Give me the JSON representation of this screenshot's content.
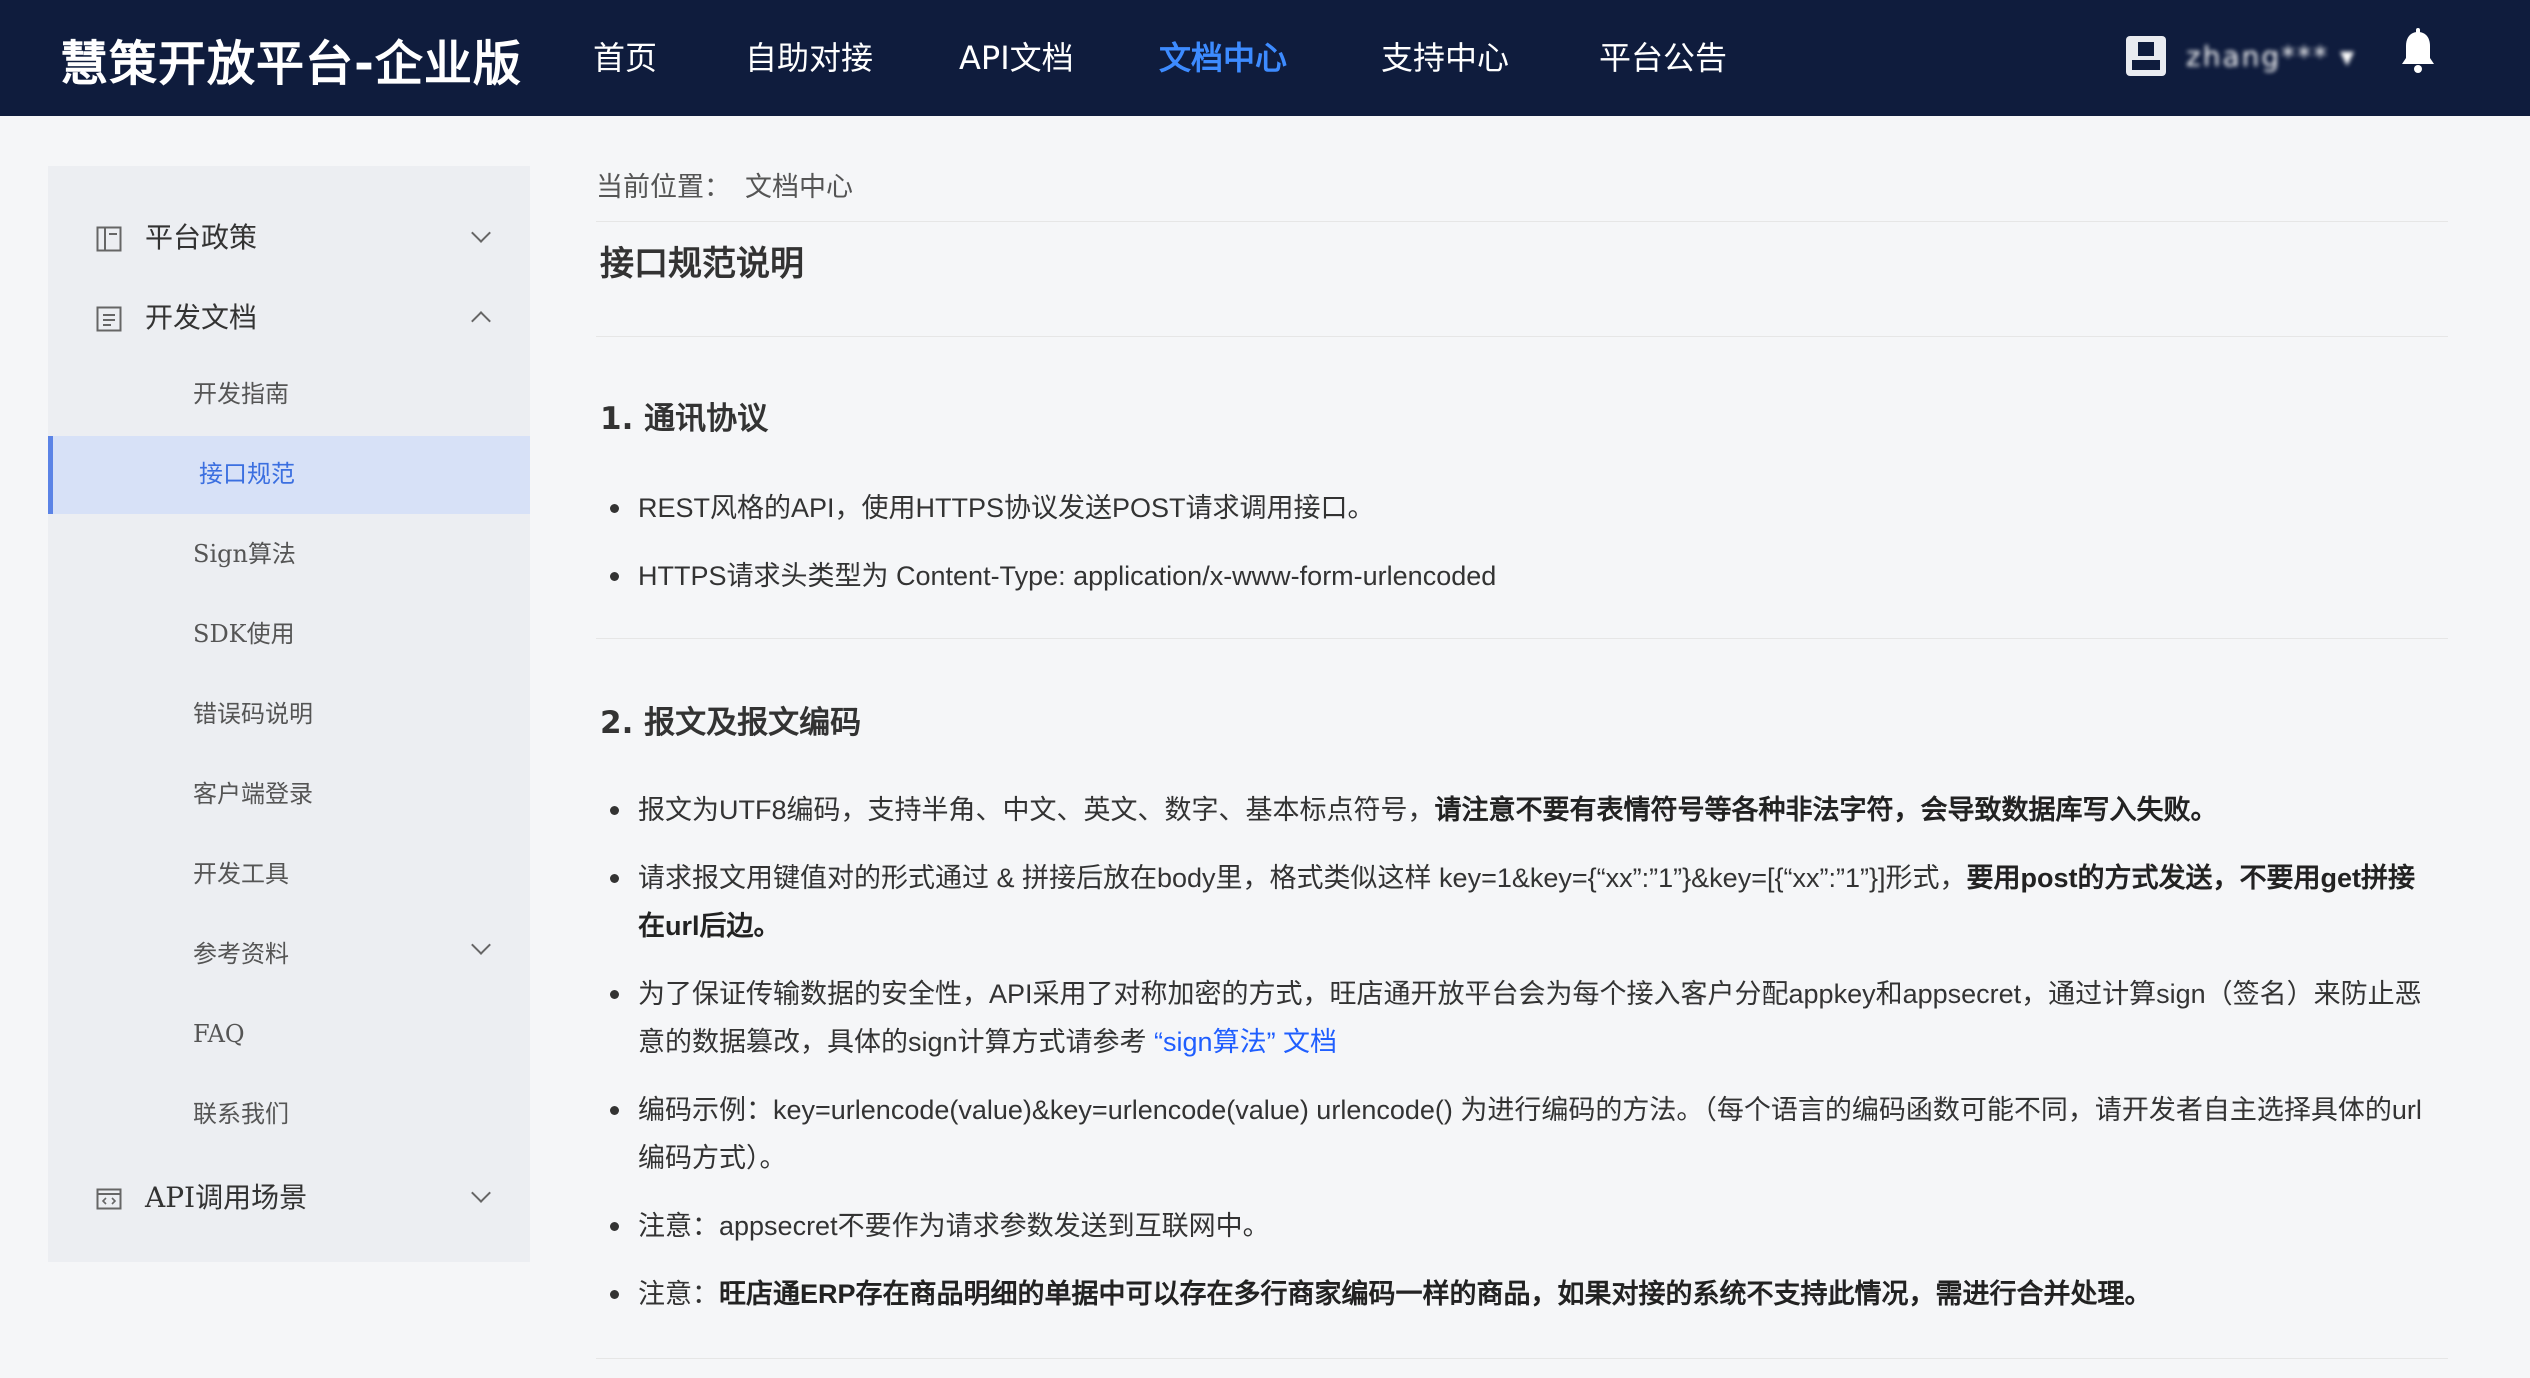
{
  "header": {
    "brand": "慧策开放平台-企业版",
    "nav": [
      {
        "label": "首页"
      },
      {
        "label": "自助对接"
      },
      {
        "label": "API文档"
      },
      {
        "label": "文档中心"
      },
      {
        "label": "支持中心"
      },
      {
        "label": "平台公告"
      }
    ],
    "active_nav": "文档中心",
    "username": "zhang*** ▾",
    "icons": {
      "avatar": "avatar-icon",
      "notification": "bell-icon"
    }
  },
  "sidebar": {
    "groups": [
      {
        "label": "平台政策",
        "icon": "policy-icon",
        "expanded": false
      },
      {
        "label": "开发文档",
        "icon": "document-icon",
        "expanded": true
      },
      {
        "label": "API调用场景",
        "icon": "api-code-icon",
        "expanded": false
      }
    ],
    "items": [
      {
        "label": "开发指南"
      },
      {
        "label": "接口规范"
      },
      {
        "label": "Sign算法"
      },
      {
        "label": "SDK使用"
      },
      {
        "label": "错误码说明"
      },
      {
        "label": "客户端登录"
      },
      {
        "label": "开发工具"
      },
      {
        "label": "参考资料"
      },
      {
        "label": "FAQ"
      },
      {
        "label": "联系我们"
      }
    ],
    "active_item": "接口规范"
  },
  "breadcrumb": {
    "prefix": "当前位置：",
    "current": "文档中心"
  },
  "page_title": "接口规范说明",
  "sections": [
    {
      "title": "1. 通讯协议",
      "bullets": [
        {
          "text": "REST风格的API，使用HTTPS协议发送POST请求调用接口。"
        },
        {
          "text": "HTTPS请求头类型为 Content-Type: application/x-www-form-urlencoded"
        }
      ]
    },
    {
      "title": "2. 报文及报文编码",
      "bullets": [
        {
          "text": "报文为UTF8编码，支持半角、中文、英文、数字、基本标点符号，",
          "bold": "请注意不要有表情符号等各种非法字符，会导致数据库写入失败。"
        },
        {
          "text": "请求报文用键值对的形式通过 & 拼接后放在body里，格式类似这样 key=1&key={“xx”:”1”}&key=[{“xx”:”1”}]形式，",
          "bold": "要用post的方式发送，不要用get拼接在url后边。"
        },
        {
          "text": "为了保证传输数据的安全性，API采用了对称加密的方式，旺店通开放平台会为每个接入客户分配appkey和appsecret，通过计算sign（签名）来防止恶意的数据篡改，具体的sign计算方式请参考 ",
          "link": "“sign算法” 文档"
        },
        {
          "text": "编码示例：key=urlencode(value)&key=urlencode(value) urlencode() 为进行编码的方法。（每个语言的编码函数可能不同，请开发者自主选择具体的url编码方式）。"
        },
        {
          "text": "注意：appsecret不要作为请求参数发送到互联网中。"
        },
        {
          "text": "注意：",
          "bold": "旺店通ERP存在商品明细的单据中可以存在多行商家编码一样的商品，如果对接的系统不支持此情况，需进行合并处理。"
        }
      ]
    }
  ]
}
